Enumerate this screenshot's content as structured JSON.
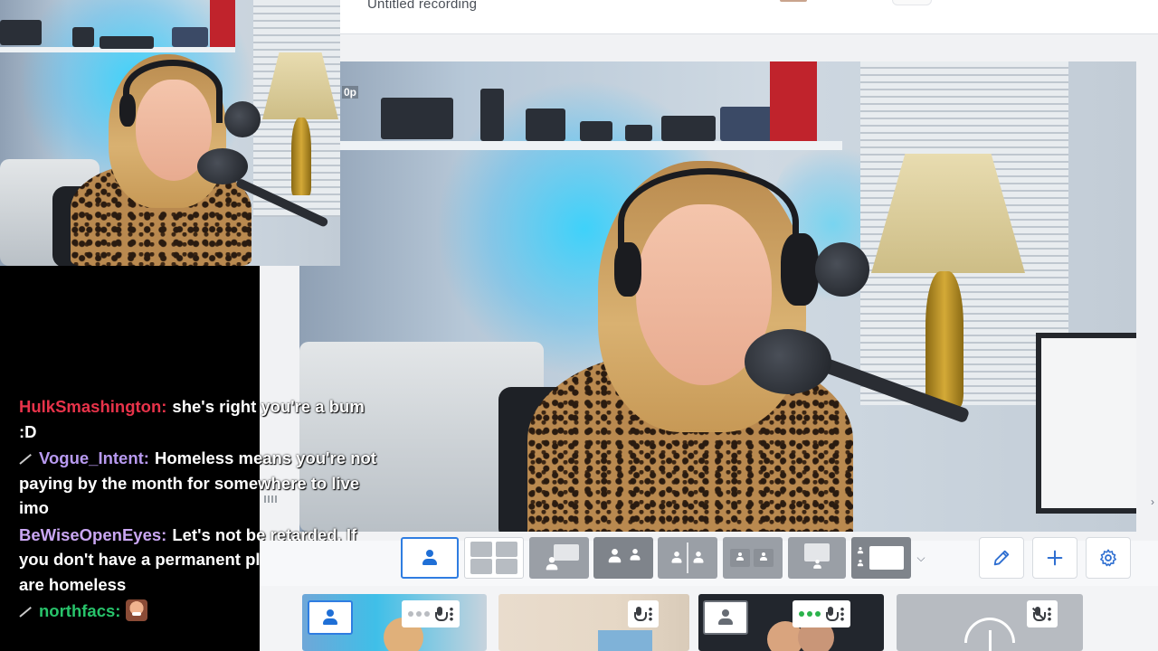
{
  "app": {
    "recording_title": "Untitled recording"
  },
  "overlay": {
    "resolution_label": "0p"
  },
  "chat": {
    "messages": [
      {
        "user": "HulkSmashington:",
        "user_color": "#e8334a",
        "badge": false,
        "text": "she's right you're a bum :D",
        "emote": null
      },
      {
        "user": "Vogue_Intent:",
        "user_color": "#b89af0",
        "badge": true,
        "text": "Homeless means you're not paying by the month for somewhere to live imo",
        "emote": null
      },
      {
        "user": "BeWiseOpenEyes:",
        "user_color": "#c9a6f2",
        "badge": false,
        "text": "Let's not be retarded. If you don't have a permanent place to live, you are homeless",
        "emote": null
      },
      {
        "user": "northfacs:",
        "user_color": "#28c46b",
        "badge": true,
        "text": "",
        "emote": "face-emote"
      }
    ]
  },
  "layout_toolbar": {
    "buttons": [
      {
        "name": "layout-solo",
        "icon": "person-icon",
        "active": true
      },
      {
        "name": "layout-grid-four",
        "icon": "grid-four-icon",
        "active": false
      },
      {
        "name": "layout-presentation",
        "icon": "presentation-icon",
        "active": false
      },
      {
        "name": "layout-side-by-side",
        "icon": "two-person-icon",
        "active": false
      },
      {
        "name": "layout-split",
        "icon": "split-icon",
        "active": false
      },
      {
        "name": "layout-picture-in-picture",
        "icon": "pip-icon",
        "active": false
      },
      {
        "name": "layout-screen-focus",
        "icon": "screen-icon",
        "active": false
      },
      {
        "name": "layout-screen-sidebar",
        "icon": "screen-sidebar-icon",
        "active": false
      }
    ],
    "more_icon": "chevron-down-icon",
    "tools": [
      {
        "name": "edit-button",
        "icon": "pencil-icon"
      },
      {
        "name": "add-button",
        "icon": "plus-icon"
      },
      {
        "name": "settings-button",
        "icon": "gear-icon"
      }
    ]
  },
  "participants": [
    {
      "name": "participant-tile-1",
      "has_avatar": true,
      "mic": "on",
      "level": "idle"
    },
    {
      "name": "participant-tile-2",
      "has_avatar": false,
      "mic": "on",
      "level": "none"
    },
    {
      "name": "participant-tile-3",
      "has_avatar": true,
      "mic": "on",
      "level": "speaking"
    },
    {
      "name": "participant-tile-4",
      "has_avatar": false,
      "mic": "muted",
      "level": "none"
    }
  ],
  "colors": {
    "accent": "#2f7de1",
    "speaking": "#2bb24c",
    "chat_bg": "#000000"
  }
}
